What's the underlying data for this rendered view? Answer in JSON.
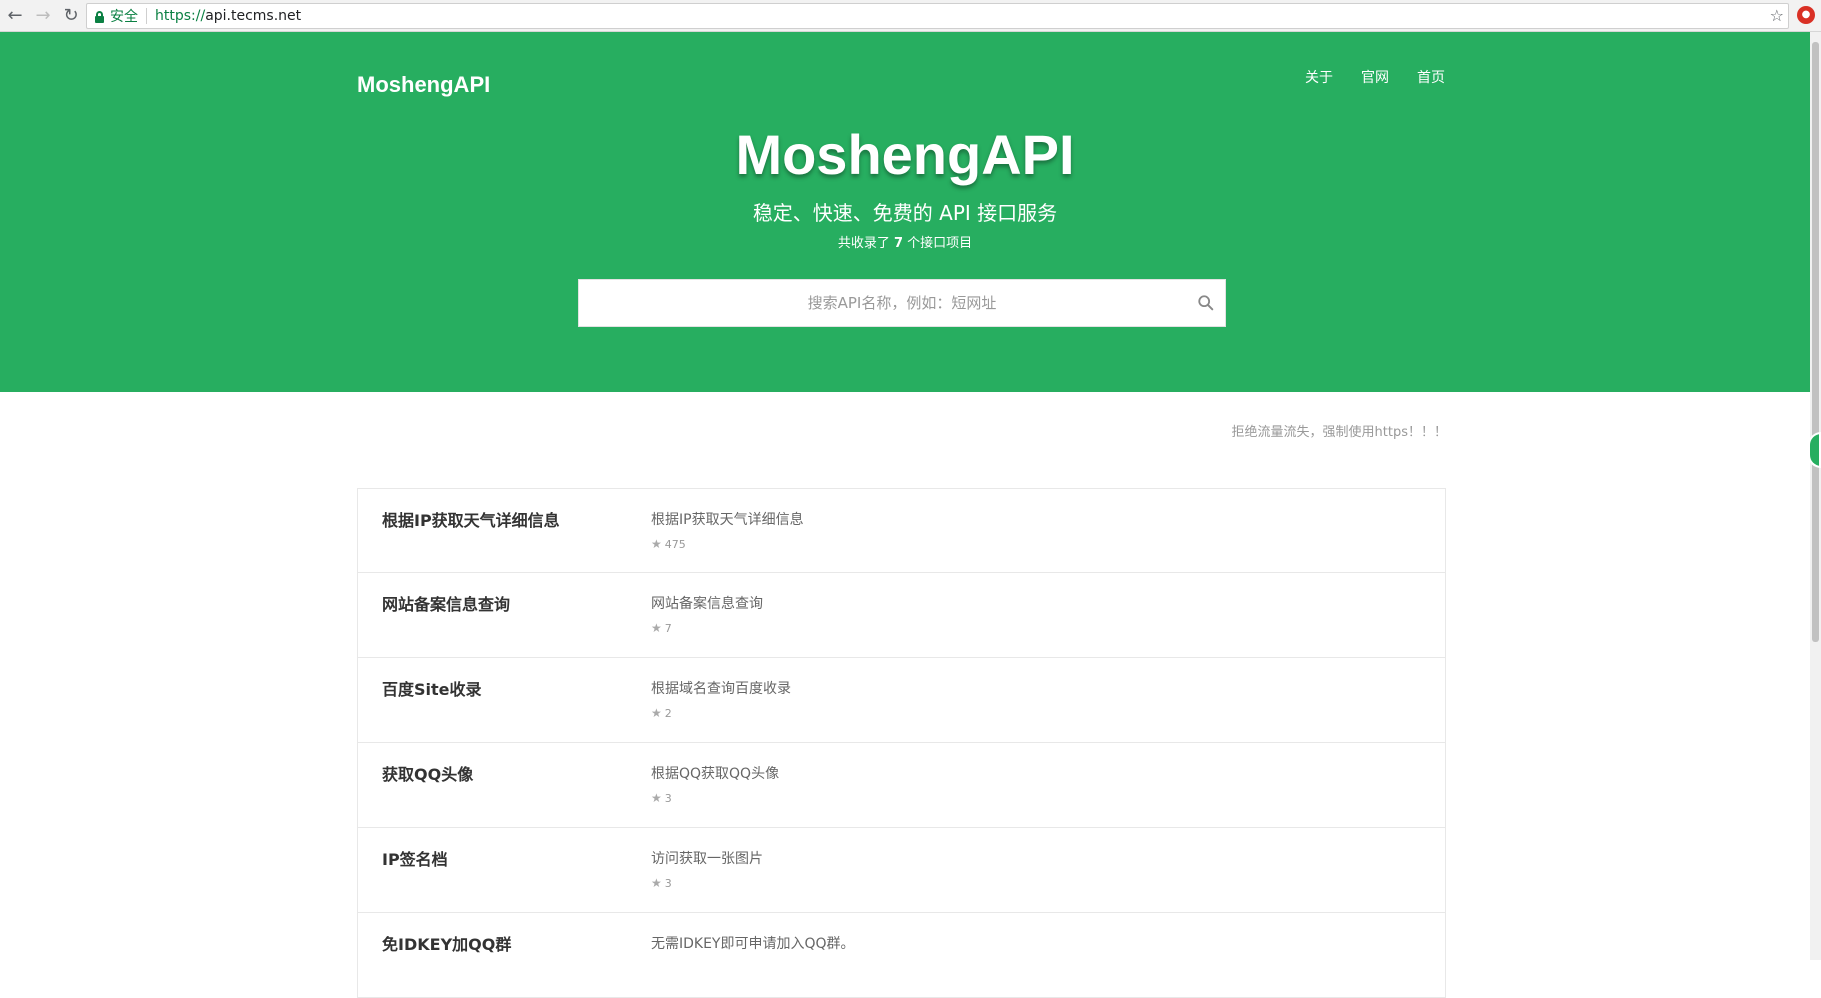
{
  "browser": {
    "secure_label": "安全",
    "url_scheme": "https://",
    "url_host": "api.tecms.net"
  },
  "header": {
    "brand": "MoshengAPI",
    "nav": [
      "关于",
      "官网",
      "首页"
    ],
    "title": "MoshengAPI",
    "subtitle": "稳定、快速、免费的 API 接口服务",
    "count_prefix": "共收录了",
    "count_value": "7",
    "count_suffix": "个接口项目",
    "search_placeholder": "搜索API名称，例如：短网址"
  },
  "notice": "拒绝流量流失，强制使用https！！！",
  "apis": [
    {
      "name": "根据IP获取天气详细信息",
      "desc": "根据IP获取天气详细信息",
      "stars": "475"
    },
    {
      "name": "网站备案信息查询",
      "desc": "网站备案信息查询",
      "stars": "7"
    },
    {
      "name": "百度Site收录",
      "desc": "根据域名查询百度收录",
      "stars": "2"
    },
    {
      "name": "获取QQ头像",
      "desc": "根据QQ获取QQ头像",
      "stars": "3"
    },
    {
      "name": "IP签名档",
      "desc": "访问获取一张图片",
      "stars": "3"
    },
    {
      "name": "免IDKEY加QQ群",
      "desc": "无需IDKEY即可申请加入QQ群。",
      "stars": ""
    }
  ],
  "colors": {
    "brand_green": "#27ae60"
  }
}
